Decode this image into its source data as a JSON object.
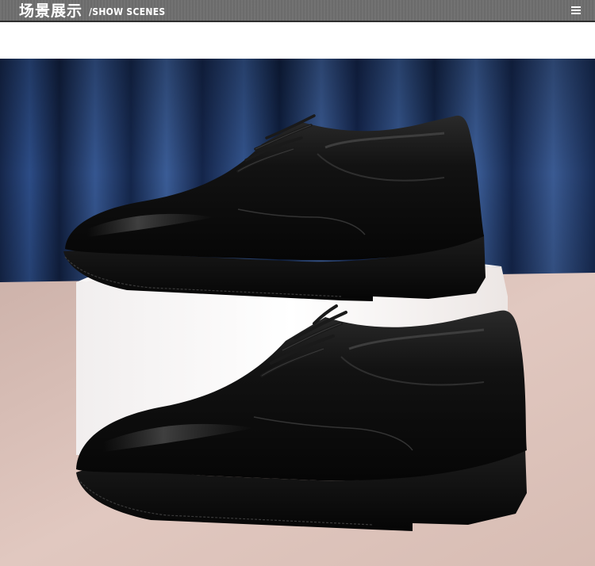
{
  "header": {
    "title_cn": "场景展示",
    "title_en": "/SHOW SCENES"
  },
  "icons": {
    "menu": "menu-icon"
  },
  "scene": {
    "description_icon": "product-photo",
    "colors": {
      "curtain": "#1f3c6e",
      "floor": "#dcc2ba",
      "pedestal": "#ffffff",
      "leather": "#141414"
    }
  }
}
